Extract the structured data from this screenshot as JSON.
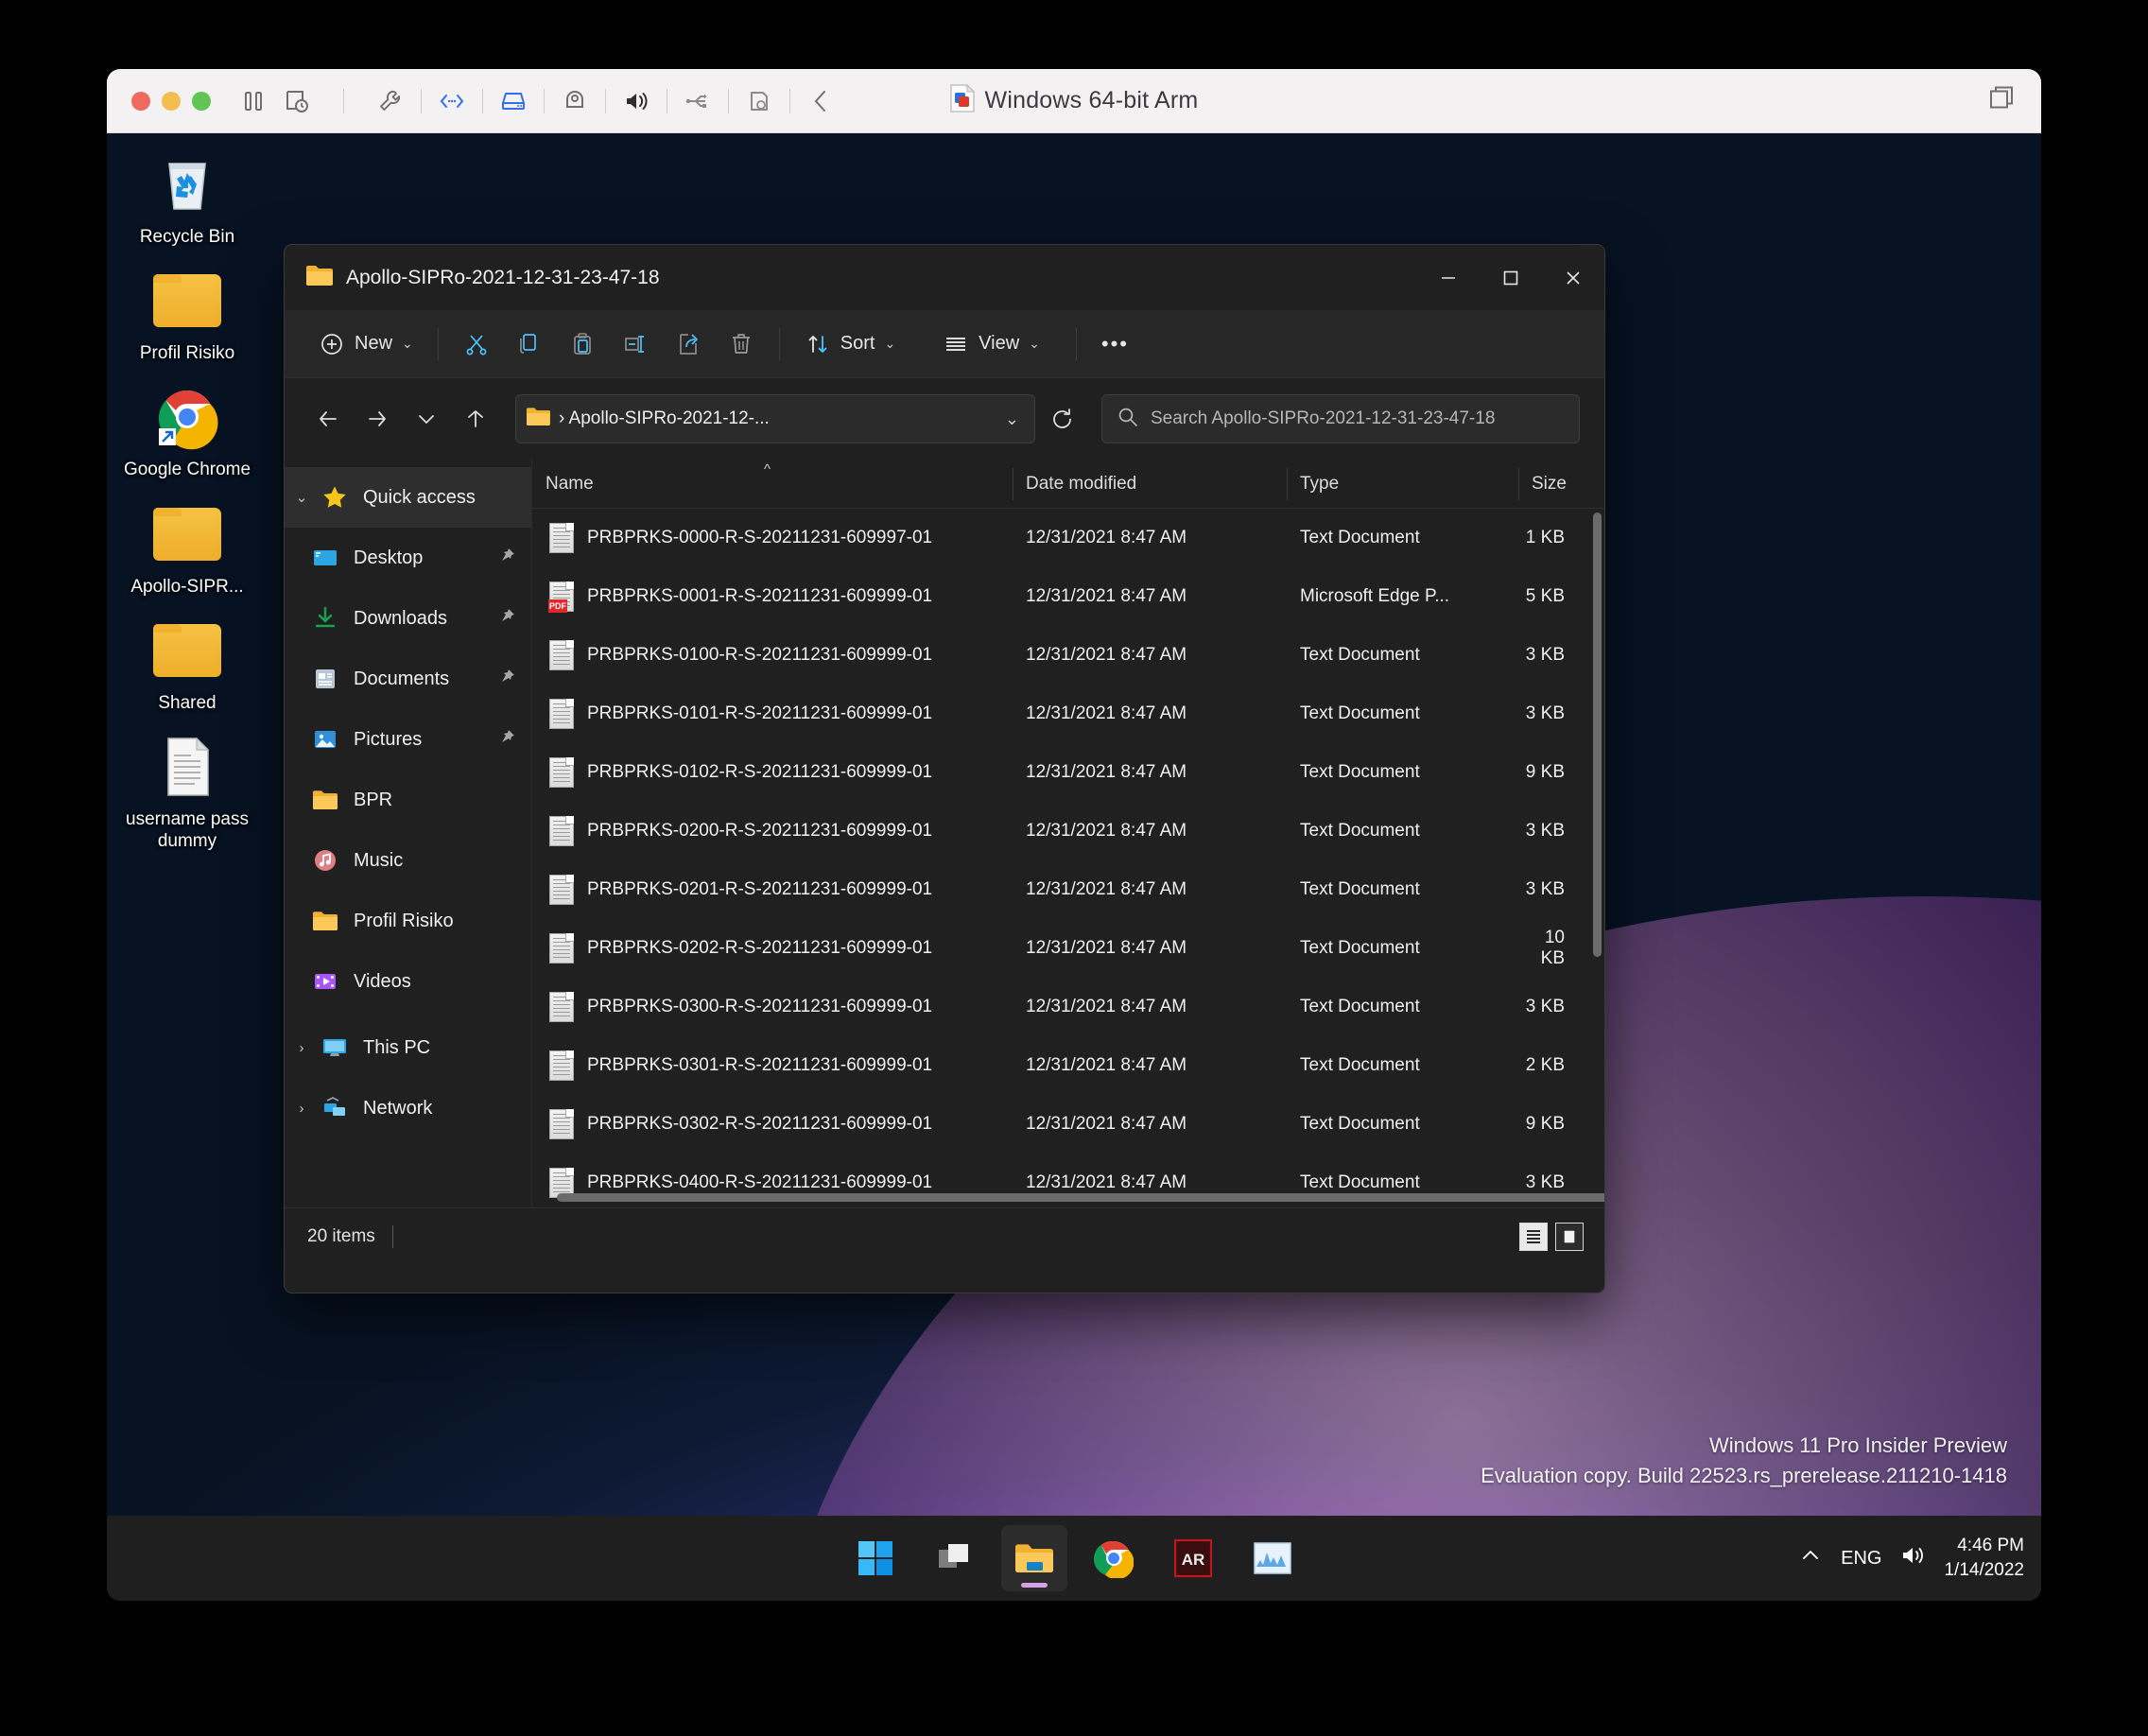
{
  "vm": {
    "title": "Windows 64-bit Arm",
    "title_icon": "parallels-vm-icon",
    "traffic_lights": [
      "close-red",
      "minimize-yellow",
      "maximize-green"
    ],
    "toolbar_icons": [
      "pause-icon",
      "snapshot-clock-icon",
      "wrench-icon",
      "network-icon",
      "harddisk-icon",
      "camera-icon",
      "speaker-icon",
      "usb-icon",
      "printer-icon",
      "collapse-chevron-icon"
    ],
    "right_icon": "window-stack-icon"
  },
  "desktop": {
    "icons": [
      {
        "label": "Recycle Bin",
        "icon": "recycle-bin-icon"
      },
      {
        "label": "Profil Risiko",
        "icon": "folder-icon"
      },
      {
        "label": "Google Chrome",
        "icon": "chrome-shortcut-icon"
      },
      {
        "label": "Apollo-SIPR...",
        "icon": "folder-icon"
      },
      {
        "label": "Shared",
        "icon": "folder-icon"
      },
      {
        "label": "username pass dummy",
        "icon": "text-document-icon"
      }
    ],
    "watermark": {
      "line1": "Windows 11 Pro Insider Preview",
      "line2": "Evaluation copy. Build 22523.rs_prerelease.211210-1418"
    }
  },
  "explorer": {
    "title": "Apollo-SIPRo-2021-12-31-23-47-18",
    "title_icon": "folder-icon",
    "window_controls": {
      "minimize": "—",
      "maximize": "☐",
      "close": "✕"
    },
    "toolbar": {
      "new_label": "New",
      "new_icon": "plus-circle-icon",
      "cut_icon": "scissors-icon",
      "copy_icon": "copy-icon",
      "paste_icon": "paste-icon",
      "rename_icon": "rename-icon",
      "share_icon": "share-icon",
      "delete_icon": "trash-icon",
      "sort_label": "Sort",
      "sort_icon": "sort-arrows-icon",
      "view_label": "View",
      "view_icon": "view-lines-icon",
      "more_label": "•••"
    },
    "address": {
      "back_icon": "arrow-left-icon",
      "forward_icon": "arrow-right-icon",
      "recent_icon": "chevron-down-icon",
      "up_icon": "arrow-up-icon",
      "folder_icon": "folder-icon",
      "breadcrumb": "› Apollo-SIPRo-2021-12-...",
      "dropdown_icon": "chevron-down-icon",
      "refresh_icon": "refresh-icon"
    },
    "search": {
      "icon": "search-icon",
      "placeholder": "Search Apollo-SIPRo-2021-12-31-23-47-18",
      "value": ""
    },
    "sidebar": {
      "quick_access": {
        "label": "Quick access",
        "icon": "star-icon",
        "expander": "chevron-down-icon"
      },
      "items": [
        {
          "label": "Desktop",
          "icon": "desktop-icon",
          "pinned": true,
          "pin_icon": "pin-icon"
        },
        {
          "label": "Downloads",
          "icon": "downloads-icon",
          "pinned": true,
          "pin_icon": "pin-icon"
        },
        {
          "label": "Documents",
          "icon": "documents-icon",
          "pinned": true,
          "pin_icon": "pin-icon"
        },
        {
          "label": "Pictures",
          "icon": "pictures-icon",
          "pinned": true,
          "pin_icon": "pin-icon"
        },
        {
          "label": "BPR",
          "icon": "folder-icon",
          "pinned": false,
          "pin_icon": ""
        },
        {
          "label": "Music",
          "icon": "music-icon",
          "pinned": false,
          "pin_icon": ""
        },
        {
          "label": "Profil Risiko",
          "icon": "folder-icon",
          "pinned": false,
          "pin_icon": ""
        },
        {
          "label": "Videos",
          "icon": "videos-icon",
          "pinned": false,
          "pin_icon": ""
        }
      ],
      "roots": [
        {
          "label": "This PC",
          "icon": "this-pc-icon",
          "expander": "chevron-right-icon"
        },
        {
          "label": "Network",
          "icon": "network-icon",
          "expander": "chevron-right-icon"
        }
      ]
    },
    "columns": {
      "name": "Name",
      "date_modified": "Date modified",
      "type": "Type",
      "size": "Size",
      "sort_indicator": "^"
    },
    "files": [
      {
        "name": "PRBPRKS-0000-R-S-20211231-609997-01",
        "date": "12/31/2021 8:47 AM",
        "type": "Text Document",
        "size": "1 KB",
        "icon": "text-document-icon"
      },
      {
        "name": "PRBPRKS-0001-R-S-20211231-609999-01",
        "date": "12/31/2021 8:47 AM",
        "type": "Microsoft Edge P...",
        "size": "5 KB",
        "icon": "pdf-document-icon"
      },
      {
        "name": "PRBPRKS-0100-R-S-20211231-609999-01",
        "date": "12/31/2021 8:47 AM",
        "type": "Text Document",
        "size": "3 KB",
        "icon": "text-document-icon"
      },
      {
        "name": "PRBPRKS-0101-R-S-20211231-609999-01",
        "date": "12/31/2021 8:47 AM",
        "type": "Text Document",
        "size": "3 KB",
        "icon": "text-document-icon"
      },
      {
        "name": "PRBPRKS-0102-R-S-20211231-609999-01",
        "date": "12/31/2021 8:47 AM",
        "type": "Text Document",
        "size": "9 KB",
        "icon": "text-document-icon"
      },
      {
        "name": "PRBPRKS-0200-R-S-20211231-609999-01",
        "date": "12/31/2021 8:47 AM",
        "type": "Text Document",
        "size": "3 KB",
        "icon": "text-document-icon"
      },
      {
        "name": "PRBPRKS-0201-R-S-20211231-609999-01",
        "date": "12/31/2021 8:47 AM",
        "type": "Text Document",
        "size": "3 KB",
        "icon": "text-document-icon"
      },
      {
        "name": "PRBPRKS-0202-R-S-20211231-609999-01",
        "date": "12/31/2021 8:47 AM",
        "type": "Text Document",
        "size": "10 KB",
        "icon": "text-document-icon"
      },
      {
        "name": "PRBPRKS-0300-R-S-20211231-609999-01",
        "date": "12/31/2021 8:47 AM",
        "type": "Text Document",
        "size": "3 KB",
        "icon": "text-document-icon"
      },
      {
        "name": "PRBPRKS-0301-R-S-20211231-609999-01",
        "date": "12/31/2021 8:47 AM",
        "type": "Text Document",
        "size": "2 KB",
        "icon": "text-document-icon"
      },
      {
        "name": "PRBPRKS-0302-R-S-20211231-609999-01",
        "date": "12/31/2021 8:47 AM",
        "type": "Text Document",
        "size": "9 KB",
        "icon": "text-document-icon"
      },
      {
        "name": "PRBPRKS-0400-R-S-20211231-609999-01",
        "date": "12/31/2021 8:47 AM",
        "type": "Text Document",
        "size": "3 KB",
        "icon": "text-document-icon"
      }
    ],
    "status": {
      "item_count": "20 items",
      "details_view_icon": "details-view-icon",
      "large_icons_view_icon": "large-icons-view-icon"
    }
  },
  "taskbar": {
    "apps": [
      {
        "name": "start-button",
        "icon": "windows-logo-icon",
        "active": false
      },
      {
        "name": "task-view",
        "icon": "task-view-icon",
        "active": false
      },
      {
        "name": "file-explorer",
        "icon": "folder-icon",
        "active": true
      },
      {
        "name": "google-chrome",
        "icon": "chrome-icon",
        "active": false
      },
      {
        "name": "ar-app",
        "icon": "ar-app-icon",
        "active": false
      },
      {
        "name": "performance-app",
        "icon": "chart-icon",
        "active": false
      }
    ],
    "tray": {
      "overflow_icon": "chevron-up-icon",
      "language": "ENG",
      "volume_icon": "speaker-icon",
      "time": "4:46 PM",
      "date": "1/14/2022"
    }
  },
  "colors": {
    "accent_blue": "#4cc2ff",
    "explorer_bg": "#202020",
    "toolbar_bg": "#272727",
    "folder_yellow": "#f7bd3e",
    "pdf_red": "#e3262a"
  }
}
